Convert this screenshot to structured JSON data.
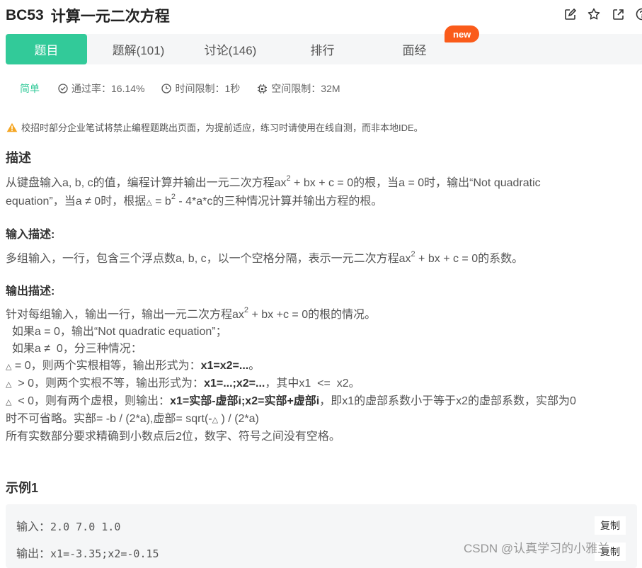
{
  "problem": {
    "id": "BC53",
    "name": "计算一元二次方程"
  },
  "top_icons": [
    "edit-icon",
    "star-icon",
    "share-icon",
    "help-icon"
  ],
  "tabs": [
    {
      "label": "题目",
      "active": true
    },
    {
      "label": "题解(101)",
      "active": false
    },
    {
      "label": "讨论(146)",
      "active": false
    },
    {
      "label": "排行",
      "active": false
    },
    {
      "label": "面经",
      "active": false
    }
  ],
  "new_badge": "new",
  "meta": {
    "difficulty": "简单",
    "pass_rate": "通过率：16.14%",
    "time_limit": "时间限制：1秒",
    "space_limit": "空间限制：32M"
  },
  "notice": "校招时部分企业笔试将禁止编程题跳出页面，为提前适应，练习时请使用在线自测，而非本地IDE。",
  "description": {
    "heading": "描述",
    "line1_a": "从键盘输入a, b, c的值，编程计算并输出一元二次方程ax",
    "line1_sup": "2",
    "line1_b": " + bx + c = 0的根，当a = 0时，输出“Not quadratic",
    "line2_a": "equation”，当a ≠ 0时，根据",
    "line2_tri": "△",
    "line2_b": " = b",
    "line2_sup": "2",
    "line2_c": " - 4*a*c的三种情况计算并输出方程的根。"
  },
  "input_desc": {
    "heading": "输入描述:",
    "text_a": "多组输入，一行，包含三个浮点数a, b, c，以一个空格分隔，表示一元二次方程ax",
    "sup": "2",
    "text_b": " + bx + c = 0的系数。"
  },
  "output_desc": {
    "heading": "输出描述:",
    "l1_a": "针对每组输入，输出一行，输出一元二次方程ax",
    "l1_sup": "2",
    "l1_b": " + bx +c = 0的根的情况。",
    "l2": "  如果a = 0，输出“Not quadratic equation”；",
    "l3": "  如果a ≠  0，分三种情况：",
    "tri": "△",
    "l4_a": " = 0，则两个实根相等，输出形式为：",
    "l4_b": "x1=x2=...",
    "l4_c": "。",
    "l5_a": "  > 0，则两个实根不等，输出形式为：",
    "l5_b": "x1=...;x2=...",
    "l5_c": "，其中x1  <=  x2。",
    "l6_a": "  < 0，则有两个虚根，则输出：",
    "l6_b": "x1=实部-虚部i;x2=实部+虚部i",
    "l6_c": "，即x1的虚部系数小于等于x2的虚部系数，实部为0",
    "l7_a": "时不可省略。实部= -b / (2*a),虚部= sqrt(-",
    "l7_b": " ) / (2*a)",
    "l8": "所有实数部分要求精确到小数点后2位，数字、符号之间没有空格。"
  },
  "example": {
    "heading": "示例1",
    "input_label": "输入：",
    "input_value": "2.0 7.0 1.0",
    "output_label": "输出：",
    "output_value": "x1=-3.35;x2=-0.15",
    "copy_label": "复制"
  },
  "watermark": "CSDN @认真学习的小雅兰.",
  "colors": {
    "accent": "#32ca99",
    "badge": "#fa5b1a",
    "tab_bg": "#f5f6f7"
  }
}
